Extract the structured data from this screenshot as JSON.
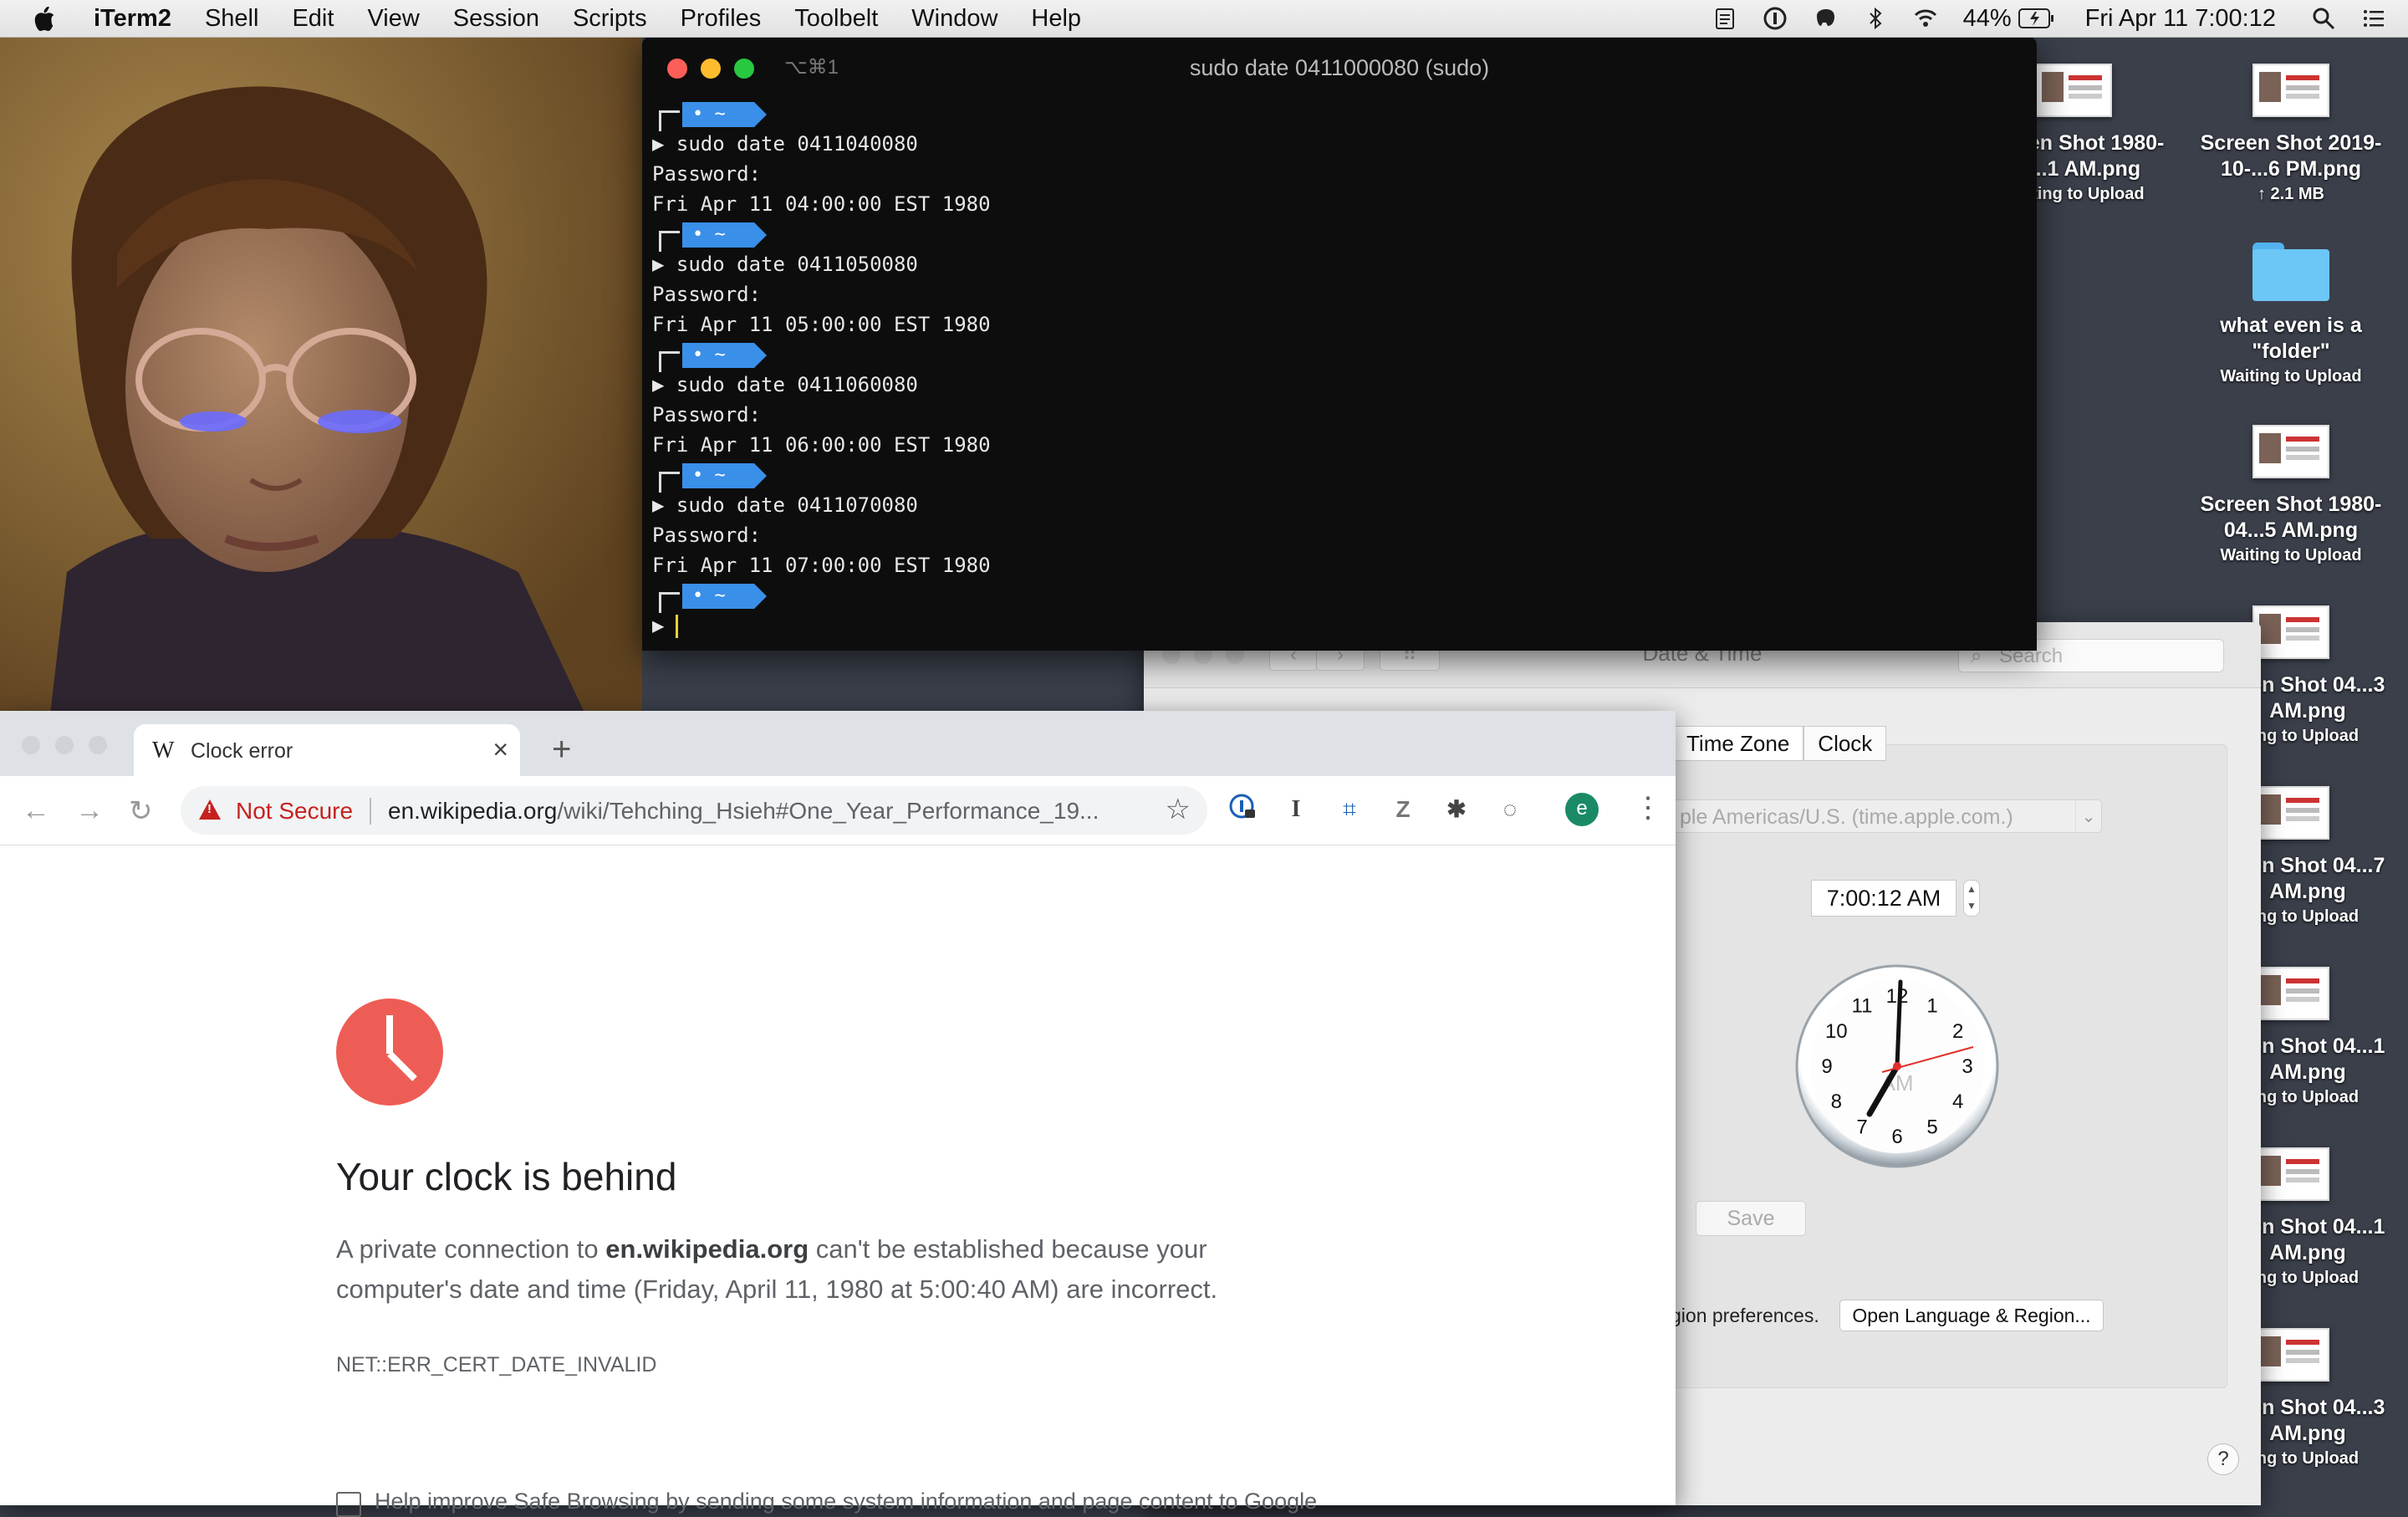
{
  "menubar": {
    "app": "iTerm2",
    "items": [
      "Shell",
      "Edit",
      "View",
      "Session",
      "Scripts",
      "Profiles",
      "Toolbelt",
      "Window",
      "Help"
    ],
    "battery": "44%",
    "datetime": "Fri Apr 11  7:00:12"
  },
  "desktop": {
    "icons": [
      {
        "name": "Screen Shot 1980-04...1 AM.png",
        "status": "Waiting to Upload"
      },
      {
        "name": "Screen Shot 2019-10-...6 PM.png",
        "status": "↑ 2.1 MB"
      },
      {
        "name": "what even is a \"folder\"",
        "status": "Waiting to Upload"
      },
      {
        "name": "Screen Shot 1980-04...5 AM.png",
        "status": "Waiting to Upload"
      },
      {
        "name": "reen Shot 04...3 AM.png",
        "status": "ng to Upload"
      },
      {
        "name": "reen Shot 04...7 AM.png",
        "status": "ng to Upload"
      },
      {
        "name": "reen Shot 04...1 AM.png",
        "status": "ng to Upload"
      },
      {
        "name": "reen Shot 04...1 AM.png",
        "status": "ng to Upload"
      },
      {
        "name": "reen Shot 04...3 AM.png",
        "status": "ng to Upload"
      }
    ]
  },
  "terminal": {
    "tab_shortcut": "⌥⌘1",
    "title": "sudo date 0411000080 (sudo)",
    "prompt_label": "• ~",
    "blocks": [
      {
        "cmd": "▶ sudo date 0411040080",
        "pw": "Password:",
        "out": "Fri Apr 11 04:00:00 EST 1980"
      },
      {
        "cmd": "▶ sudo date 0411050080",
        "pw": "Password:",
        "out": "Fri Apr 11 05:00:00 EST 1980"
      },
      {
        "cmd": "▶ sudo date 0411060080",
        "pw": "Password:",
        "out": "Fri Apr 11 06:00:00 EST 1980"
      },
      {
        "cmd": "▶ sudo date 0411070080",
        "pw": "Password:",
        "out": "Fri Apr 11 07:00:00 EST 1980"
      }
    ],
    "final_prompt": "▶"
  },
  "prefs": {
    "title": "Date & Time",
    "search_placeholder": "Search",
    "tabs": [
      "Time Zone",
      "Clock"
    ],
    "time_server": "ple Americas/U.S. (time.apple.com.)",
    "time": "7:00:12 AM",
    "clock_ampm": "AM",
    "clock_numbers": [
      "12",
      "1",
      "2",
      "3",
      "4",
      "5",
      "6",
      "7",
      "8",
      "9",
      "10",
      "11"
    ],
    "save": "Save",
    "region_text": "gion preferences.",
    "region_button": "Open Language & Region...",
    "help": "?"
  },
  "chrome": {
    "tab_title": "Clock error",
    "favicon": "W",
    "not_secure": "Not Secure",
    "url_host": "en.wikipedia.org",
    "url_path": "/wiki/Tehching_Hsieh#One_Year_Performance_19...",
    "profile_initial": "e",
    "heading": "Your clock is behind",
    "para_pre": "A private connection to ",
    "para_host": "en.wikipedia.org",
    "para_post": " can't be established because your computer's date and time (Friday, April 11, 1980 at 5:00:40 AM) are incorrect.",
    "error_code": "NET::ERR_CERT_DATE_INVALID",
    "checkbox_label": "Help improve Safe Browsing by sending some system information and page content to Google"
  },
  "colors": {
    "terminal_bg": "#0d0d0d",
    "prompt_blue": "#3a8fe8",
    "error_red": "#ee5d55",
    "not_secure_red": "#c5221f"
  }
}
